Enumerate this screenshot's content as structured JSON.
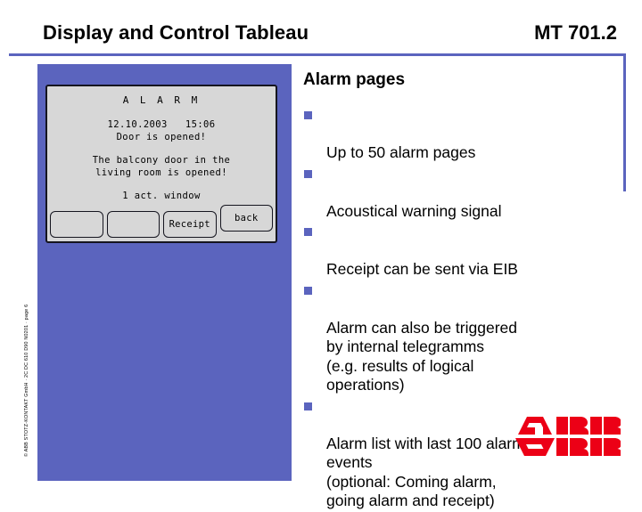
{
  "header": {
    "title": "Display and Control Tableau",
    "code": "MT 701.2"
  },
  "lcd": {
    "title": "A L A R M",
    "datetime": "12.10.2003   15:06",
    "message_short": "Door is opened!",
    "message_long_line1": "The balcony door in the",
    "message_long_line2": "living room is opened!",
    "window_count": "1 act. window",
    "buttons": [
      {
        "label": "",
        "name": "lcd-softkey-1"
      },
      {
        "label": "",
        "name": "lcd-softkey-2"
      },
      {
        "label": "Receipt",
        "name": "lcd-receipt-button"
      },
      {
        "label": "back",
        "name": "lcd-back-button"
      }
    ]
  },
  "content": {
    "heading": "Alarm pages",
    "bullets": [
      "Up to 50 alarm pages",
      "Acoustical warning signal",
      "Receipt can be sent via EIB",
      "Alarm can also be triggered\nby internal telegramms\n(e.g. results of logical\noperations)",
      "Alarm list with last 100 alarm\nevents\n(optional: Coming alarm,\ngoing alarm and receipt)"
    ]
  },
  "footer": {
    "copyright": "© ABB STOTZ-KONTAKT GmbH · 2C DC 610 D90 N0201 · page 6"
  },
  "logo": {
    "text": "ABB"
  },
  "colors": {
    "accent_blue": "#5b64be",
    "lcd_background": "#d7d7d7",
    "logo_red": "#ec0016",
    "text": "#000000"
  }
}
